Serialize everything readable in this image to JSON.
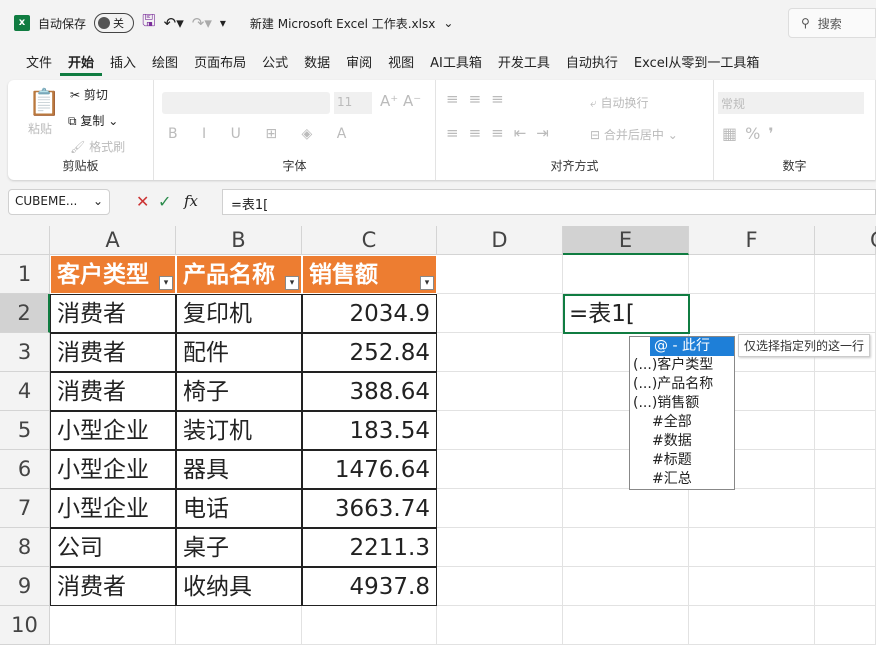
{
  "titlebar": {
    "autosave_label": "自动保存",
    "autosave_state": "关",
    "filename": "新建 Microsoft Excel 工作表.xlsx",
    "search_placeholder": "搜索"
  },
  "tabs": [
    "文件",
    "开始",
    "插入",
    "绘图",
    "页面布局",
    "公式",
    "数据",
    "审阅",
    "视图",
    "AI工具箱",
    "开发工具",
    "自动执行",
    "Excel从零到一工具箱"
  ],
  "ribbon": {
    "paste": "粘贴",
    "cut": "剪切",
    "copy": "复制",
    "format_painter": "格式刷",
    "clipboard": "剪贴板",
    "font_size": "11",
    "font": "字体",
    "wrap": "自动换行",
    "merge": "合并后居中",
    "alignment": "对齐方式",
    "number_format": "常规",
    "number": "数字"
  },
  "formula_bar": {
    "name_box": "CUBEME...",
    "fx": "fx",
    "formula": "=表1["
  },
  "columns": [
    "A",
    "B",
    "C",
    "D",
    "E",
    "F",
    "G"
  ],
  "rows": [
    "1",
    "2",
    "3",
    "4",
    "5",
    "6",
    "7",
    "8",
    "9",
    "10"
  ],
  "table": {
    "headers": [
      "客户类型",
      "产品名称",
      "销售额"
    ],
    "data": [
      [
        "消费者",
        "复印机",
        "2034.9"
      ],
      [
        "消费者",
        "配件",
        "252.84"
      ],
      [
        "消费者",
        "椅子",
        "388.64"
      ],
      [
        "小型企业",
        "装订机",
        "183.54"
      ],
      [
        "小型企业",
        "器具",
        "1476.64"
      ],
      [
        "小型企业",
        "电话",
        "3663.74"
      ],
      [
        "公司",
        "桌子",
        "2211.3"
      ],
      [
        "消费者",
        "收纳具",
        "4937.8"
      ]
    ]
  },
  "active_cell": {
    "text": "=表1["
  },
  "autocomplete": {
    "items": [
      "@ - 此行",
      "(...)客户类型",
      "(...)产品名称",
      "(...)销售额",
      "#全部",
      "#数据",
      "#标题",
      "#汇总"
    ],
    "tooltip": "仅选择指定列的这一行"
  },
  "colors": {
    "header": "#ed7d31",
    "accent": "#107c41",
    "selection": "#1e7fd8"
  }
}
